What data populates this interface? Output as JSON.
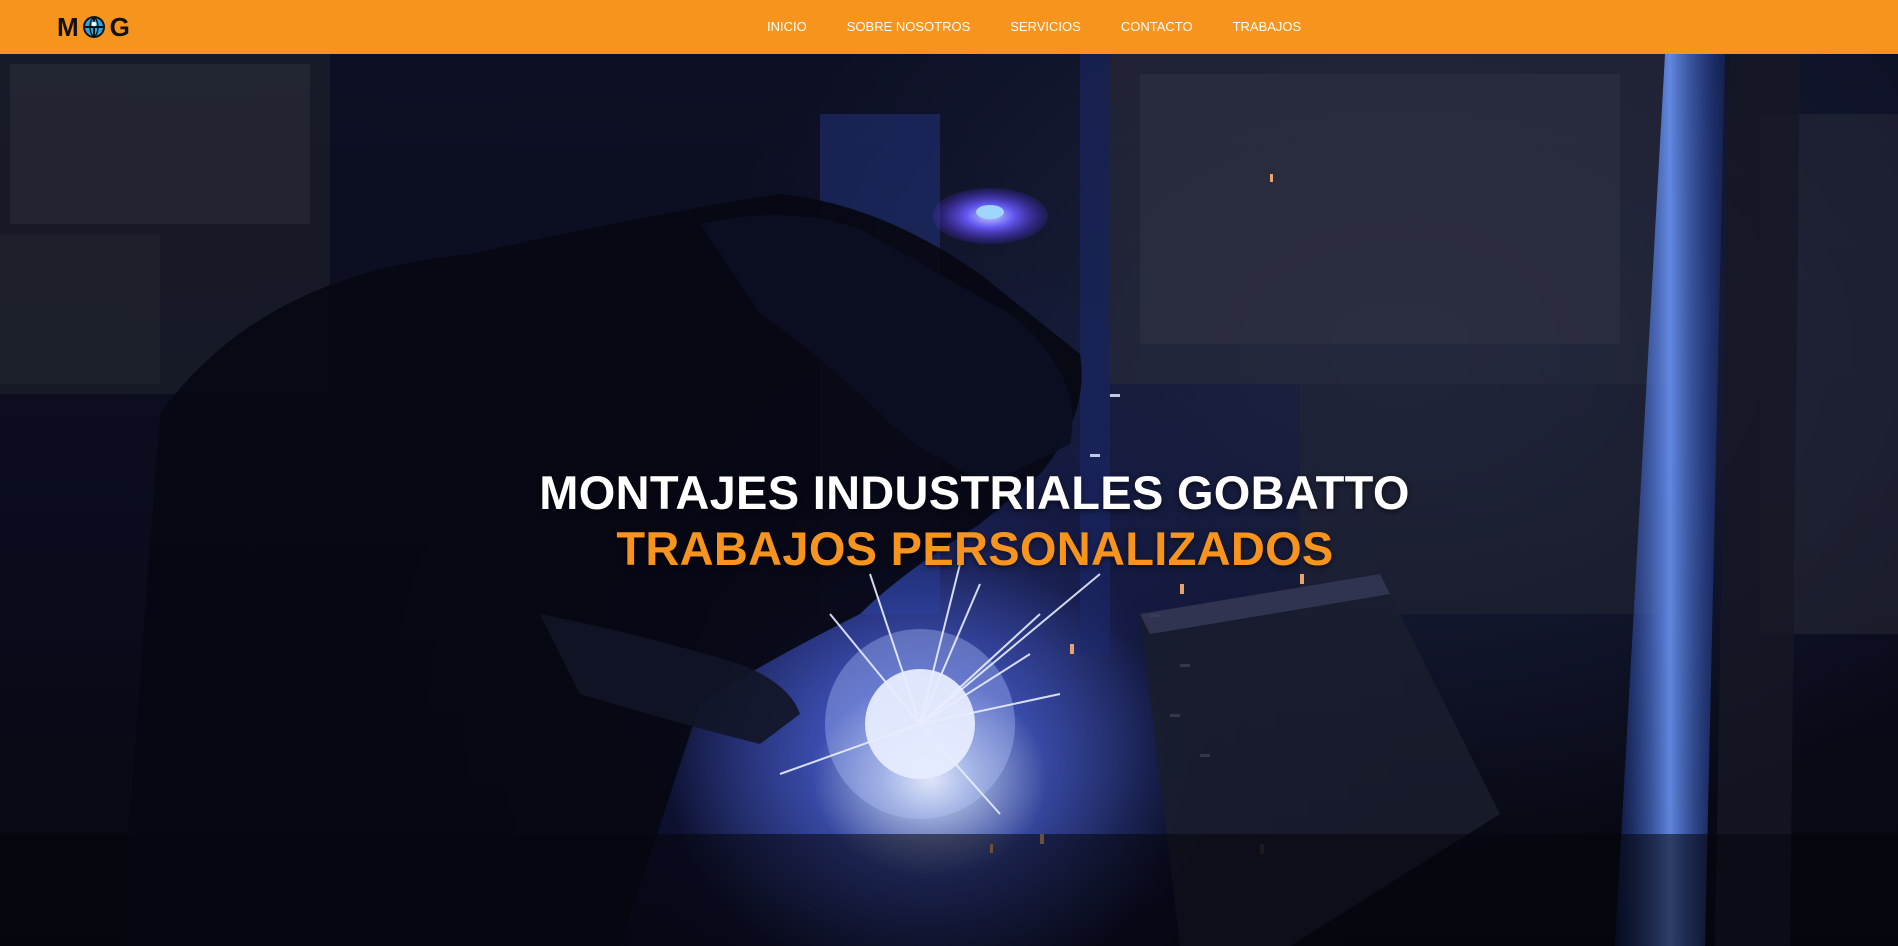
{
  "brand": {
    "logo_text_left": "M",
    "logo_text_right": "G",
    "logo_icon": "globe-icon",
    "accent_color": "#f7941d"
  },
  "nav": {
    "items": [
      {
        "label": "INICIO"
      },
      {
        "label": "SOBRE NOSOTROS"
      },
      {
        "label": "SERVICIOS"
      },
      {
        "label": "CONTACTO"
      },
      {
        "label": "TRABAJOS"
      }
    ]
  },
  "hero": {
    "title": "MONTAJES INDUSTRIALES GOBATTO",
    "subtitle": "TRABAJOS PERSONALIZADOS",
    "title_color": "#ffffff",
    "subtitle_color": "#f7941d",
    "background_description_icon": "welding-scene-image"
  }
}
